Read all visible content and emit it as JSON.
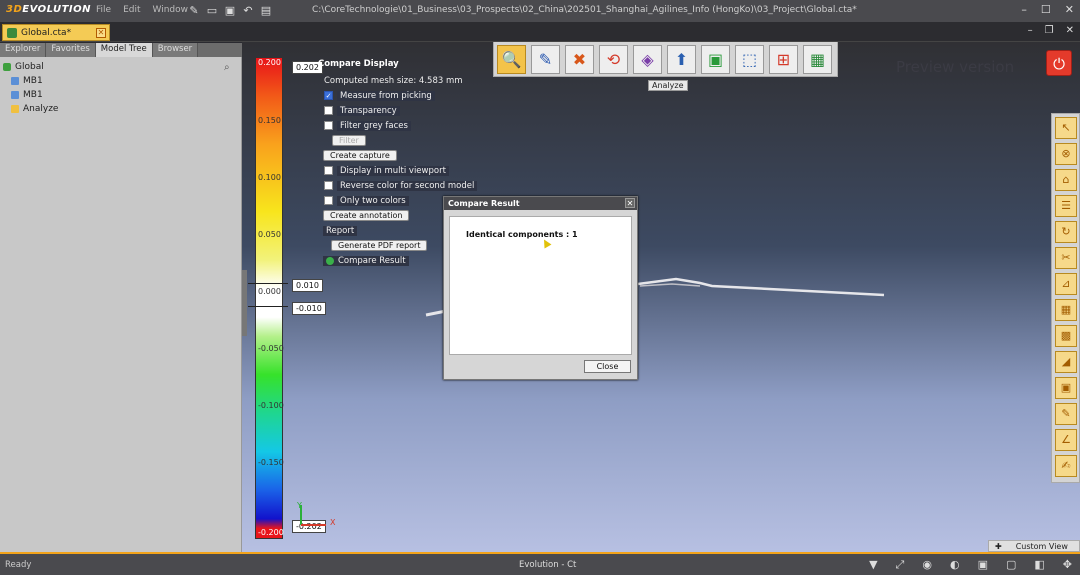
{
  "app": {
    "logo_prefix": "3D",
    "logo_text": "EVOLUTION",
    "menus": [
      "File",
      "Edit",
      "Window"
    ],
    "window_title": "C:\\CoreTechnologie\\01_Business\\03_Prospects\\02_China\\202501_Shanghai_Agilines_Info (HongKo)\\03_Project\\Global.cta*"
  },
  "doc_tab": {
    "label": "Global.cta*"
  },
  "left_panel": {
    "tabs": [
      "Explorer",
      "Favorites",
      "Model Tree",
      "Browser"
    ],
    "active_tab": "Model Tree",
    "tree": [
      {
        "label": "Global",
        "level": 0,
        "icon": "assembly-icon"
      },
      {
        "label": "MB1",
        "level": 1,
        "icon": "part-icon"
      },
      {
        "label": "MB1",
        "level": 1,
        "icon": "part-icon"
      },
      {
        "label": "Analyze",
        "level": 1,
        "icon": "folder-icon"
      }
    ]
  },
  "color_scale": {
    "top_marker": "0.202",
    "bottom_marker": "-0.202",
    "upper_marker": "0.010",
    "lower_marker": "-0.010",
    "top_label": "0.200",
    "bottom_label": "-0.200",
    "labels": [
      "0.150",
      "0.100",
      "0.050",
      "0.000",
      "-0.050",
      "-0.100",
      "-0.150"
    ]
  },
  "compare_display": {
    "title": "Compare Display",
    "mesh_size": "Computed mesh size: 4.583 mm",
    "measure_from_picking": "Measure from picking",
    "transparency": "Transparency",
    "filter_grey_faces": "Filter grey faces",
    "filter_btn": "Filter",
    "create_capture": "Create capture",
    "display_multi_viewport": "Display in multi viewport",
    "reverse_color": "Reverse color for second model",
    "only_two_colors": "Only two colors",
    "create_annotation": "Create annotation",
    "report": "Report",
    "generate_pdf": "Generate PDF report",
    "compare_result": "Compare Result"
  },
  "toolbar": {
    "tooltip": "Analyze"
  },
  "watermark": "Preview version",
  "dialog": {
    "title": "Compare Result",
    "message": "Identical components : 1",
    "close_label": "Close"
  },
  "gizmo": {
    "x": "X",
    "y": "Y"
  },
  "custom_view": "Custom View",
  "status": {
    "left": "Ready",
    "center": "Evolution - Ct"
  }
}
